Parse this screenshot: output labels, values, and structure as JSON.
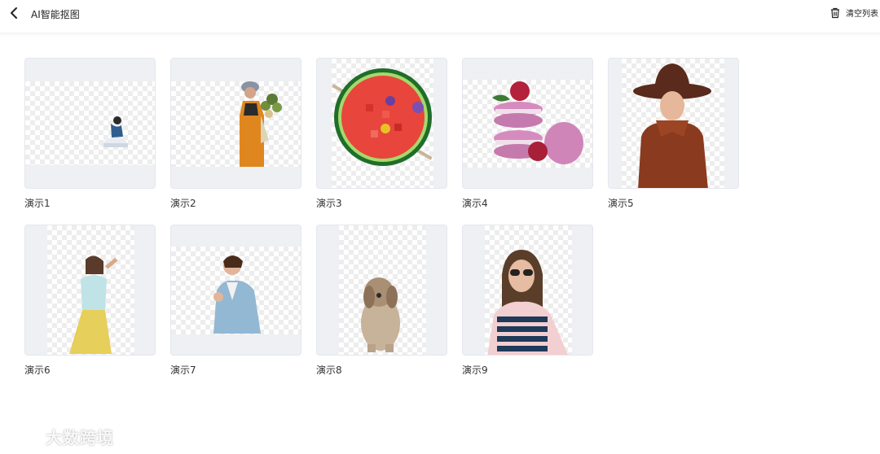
{
  "header": {
    "back_icon": "chevron-left-icon",
    "title": "AI智能抠图",
    "clear_icon": "trash-icon",
    "clear_label": "清空列表"
  },
  "items": [
    {
      "label": "演示1",
      "subject": "woman-sitting"
    },
    {
      "label": "演示2",
      "subject": "woman-with-flowers"
    },
    {
      "label": "演示3",
      "subject": "watermelon-bowl"
    },
    {
      "label": "演示4",
      "subject": "macarons"
    },
    {
      "label": "演示5",
      "subject": "woman-in-hat"
    },
    {
      "label": "演示6",
      "subject": "woman-yellow-skirt"
    },
    {
      "label": "演示7",
      "subject": "woman-blue-blazer"
    },
    {
      "label": "演示8",
      "subject": "dog"
    },
    {
      "label": "演示9",
      "subject": "woman-sunglasses"
    }
  ],
  "watermark": {
    "text": "大数跨境",
    "icon": "brand-logo-icon"
  },
  "colors": {
    "thumb_bg": "#eef0f4",
    "checker": "#ededed",
    "text": "#333333"
  }
}
